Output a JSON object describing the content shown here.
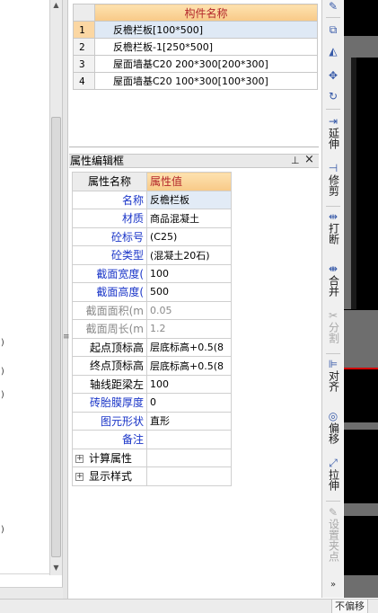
{
  "left_panel": {
    "marks": [
      ")",
      ")",
      ")",
      ")"
    ]
  },
  "component_list": {
    "header": "构件名称",
    "rows": [
      {
        "index": "1",
        "name": "反檐栏板[100*500]",
        "selected": true
      },
      {
        "index": "2",
        "name": "反檐栏板-1[250*500]",
        "selected": false
      },
      {
        "index": "3",
        "name": "屋面墙基C20 200*300[200*300]",
        "selected": false
      },
      {
        "index": "4",
        "name": "屋面墙基C20 100*300[100*300]",
        "selected": false
      }
    ]
  },
  "property_editor": {
    "title": "属性编辑框",
    "pin_glyph": "ㅁ",
    "close_glyph": "×",
    "header_name": "属性名称",
    "header_value": "属性值",
    "rows": [
      {
        "name": "名称",
        "value": "反檐栏板",
        "style": "blue"
      },
      {
        "name": "材质",
        "value": "商品混凝土",
        "style": "blue"
      },
      {
        "name": "砼标号",
        "value": "(C25)",
        "style": "blue"
      },
      {
        "name": "砼类型",
        "value": "(混凝土20石)",
        "style": "blue"
      },
      {
        "name": "截面宽度(",
        "value": "100",
        "style": "blue"
      },
      {
        "name": "截面高度(",
        "value": "500",
        "style": "blue"
      },
      {
        "name": "截面面积(m",
        "value": "0.05",
        "style": "grey"
      },
      {
        "name": "截面周长(m",
        "value": "1.2",
        "style": "grey"
      },
      {
        "name": "起点顶标高",
        "value": "层底标高+0.5(8",
        "style": "black"
      },
      {
        "name": "终点顶标高",
        "value": "层底标高+0.5(8",
        "style": "black"
      },
      {
        "name": "轴线距梁左",
        "value": "100",
        "style": "black"
      },
      {
        "name": "砖胎膜厚度",
        "value": "0",
        "style": "blue"
      },
      {
        "name": "图元形状",
        "value": "直形",
        "style": "blue"
      },
      {
        "name": "备注",
        "value": "",
        "style": "blue"
      }
    ],
    "groups": [
      {
        "name": "计算属性",
        "expander": "+"
      },
      {
        "name": "显示样式",
        "expander": "+"
      }
    ]
  },
  "toolbar": {
    "items": [
      {
        "id": "top-tool",
        "icon": "pencil-icon",
        "glyph": "✎",
        "label": "",
        "disabled": false
      },
      {
        "id": "copy",
        "icon": "copy-icon",
        "glyph": "⧉",
        "label": "",
        "disabled": false
      },
      {
        "id": "mirror",
        "icon": "mirror-icon",
        "glyph": "◭",
        "label": "",
        "disabled": false
      },
      {
        "id": "move",
        "icon": "move-icon",
        "glyph": "✥",
        "label": "",
        "disabled": false
      },
      {
        "id": "rotate",
        "icon": "rotate-icon",
        "glyph": "↻",
        "label": "",
        "disabled": false
      },
      {
        "id": "extend",
        "icon": "extend-icon",
        "glyph": "⇥",
        "label": "延伸",
        "disabled": false
      },
      {
        "id": "trim",
        "icon": "trim-icon",
        "glyph": "⊣",
        "label": "修剪",
        "disabled": false
      },
      {
        "id": "break",
        "icon": "break-icon",
        "glyph": "⇹",
        "label": "打断",
        "disabled": false
      },
      {
        "id": "merge",
        "icon": "merge-icon",
        "glyph": "⇼",
        "label": "合并",
        "disabled": false
      },
      {
        "id": "split",
        "icon": "split-icon",
        "glyph": "✂",
        "label": "分割",
        "disabled": true
      },
      {
        "id": "align",
        "icon": "align-icon",
        "glyph": "⊫",
        "label": "对齐",
        "disabled": false
      },
      {
        "id": "offset",
        "icon": "offset-icon",
        "glyph": "◎",
        "label": "偏移",
        "disabled": false
      },
      {
        "id": "stretch",
        "icon": "stretch-icon",
        "glyph": "⤢",
        "label": "拉伸",
        "disabled": false
      },
      {
        "id": "set-grip",
        "icon": "grip-icon",
        "glyph": "✎",
        "label": "设置夹点",
        "disabled": true
      }
    ],
    "more_glyph": "»"
  },
  "status_bar": {
    "mode": "不偏移"
  },
  "colors": {
    "header_orange": "#f8c987",
    "header_text": "#b3262a",
    "label_blue": "#1a35c8",
    "selection_blue": "#dfe9f5",
    "canvas_black": "#000000",
    "canvas_gray": "#6e6e6e",
    "canvas_red": "#d20000"
  }
}
